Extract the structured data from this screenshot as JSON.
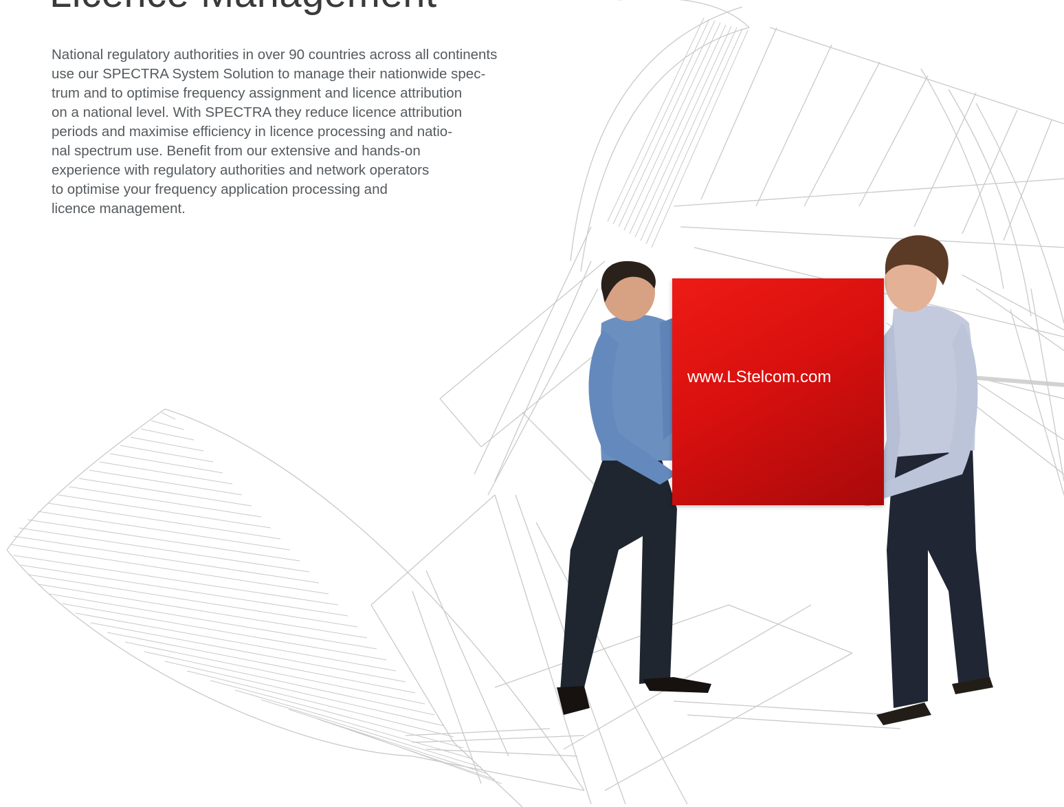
{
  "page": {
    "heading": "Licence Management",
    "body_lines": [
      "National regulatory authorities in over 90 countries across all continents",
      "use our SPECTRA System Solution to manage their nationwide spec-",
      "trum and to optimise frequency assignment and licence attribution",
      "on a national level. With SPECTRA they reduce licence attribution",
      "periods and maximise efficiency in licence processing and natio-",
      "nal spectrum use. Benefit from our extensive and hands-on",
      "experience with regulatory authorities and network operators",
      "to optimise your frequency application processing and",
      "licence management."
    ]
  },
  "photo": {
    "board_text": "www.LStelcom.com",
    "board_color": "#e0120f"
  },
  "colors": {
    "text": "#555a5e",
    "heading": "#3a3a3a",
    "line_art": "#c8c8c8"
  }
}
